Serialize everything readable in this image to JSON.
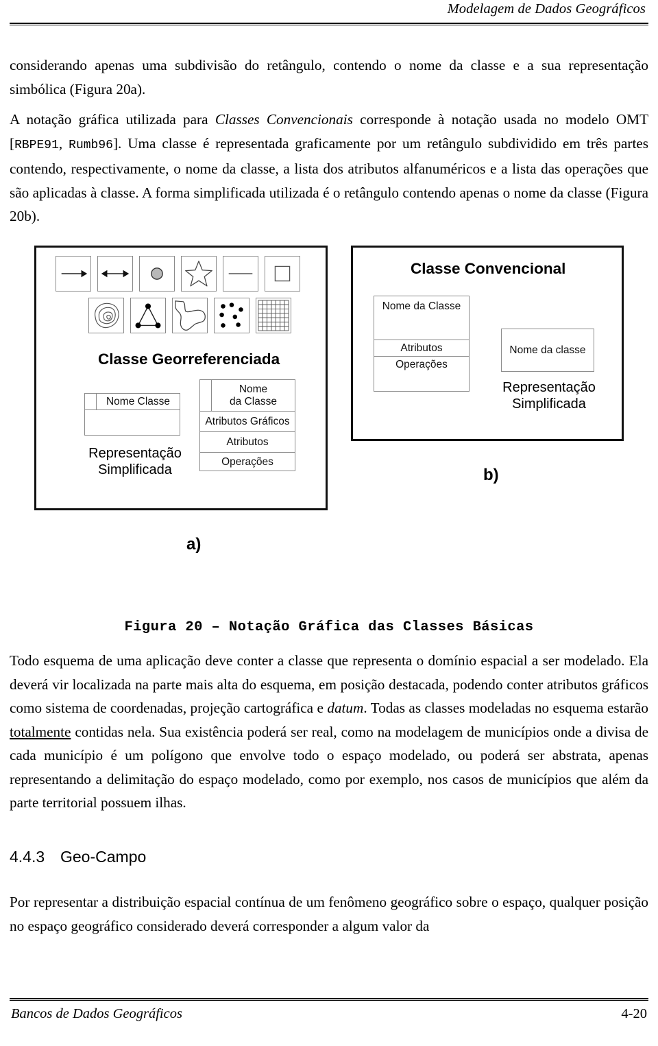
{
  "header": {
    "title": "Modelagem de Dados Geográficos"
  },
  "body": {
    "para1_a": "considerando apenas uma subdivisão do retângulo, contendo o nome da classe e a sua representação simbólica (Figura 20a).",
    "para2_a": "A notação gráfica utilizada para ",
    "para2_italic": "Classes Convencionais",
    "para2_b": " corresponde à notação usada no modelo OMT [",
    "para2_ref1": "RBPE91",
    "para2_c": ", ",
    "para2_ref2": "Rumb96",
    "para2_d": "]. Uma classe é representada graficamente por um retângulo subdividido em três partes contendo, respectivamente, o nome da classe, a lista dos atributos alfanuméricos e a lista das operações que são aplicadas à classe. A forma simplificada utilizada é o retângulo contendo apenas o nome da classe (Figura 20b).",
    "para3_a": "Todo esquema de uma aplicação deve conter a classe que representa o domínio espacial a ser modelado. Ela deverá vir localizada na parte mais alta do esquema, em posição destacada, podendo conter atributos gráficos como sistema de coordenadas, projeção cartográfica e ",
    "para3_italic": "datum",
    "para3_b": ". Todas as classes modeladas no esquema estarão ",
    "para3_underline": "totalmente",
    "para3_c": " contidas nela. Sua existência poderá ser real, como na modelagem de municípios onde a divisa de cada município é um polígono que envolve todo o espaço modelado, ou poderá ser abstrata, apenas representando a delimitação do espaço modelado, como por exemplo, nos casos de municípios que além da parte territorial possuem ilhas.",
    "para4": "Por representar a distribuição espacial contínua de um fenômeno geográfico sobre o espaço, qualquer posição no espaço geográfico considerado deverá corresponder a algum valor da"
  },
  "section": {
    "number": "4.4.3",
    "title": "Geo-Campo"
  },
  "figure": {
    "caption": "Figura 20 – Notação Gráfica das Classes Básicas",
    "panel_a_label": "a)",
    "panel_b_label": "b)",
    "panel_a": {
      "group_title": "Classe Georreferenciada",
      "symbols_row1": [
        "arrow-right-icon",
        "double-arrow-icon",
        "filled-circle-icon",
        "star-icon",
        "line-segment-icon",
        "square-icon"
      ],
      "symbols_row2": [
        "contour-lines-icon",
        "triangle-network-icon",
        "polygon-outline-icon",
        "sample-points-icon",
        "regular-grid-icon"
      ],
      "simple_class": {
        "name": "Nome Classe"
      },
      "simple_label_line1": "Representação",
      "simple_label_line2": "Simplificada",
      "full_class": {
        "name_line1": "Nome",
        "name_line2": "da Classe",
        "row_graphic_attrs": "Atributos Gráficos",
        "row_attrs": "Atributos",
        "row_ops": "Operações"
      }
    },
    "panel_b": {
      "group_title": "Classe Convencional",
      "full_class": {
        "name": "Nome da Classe",
        "row_attrs": "Atributos",
        "row_ops": "Operações"
      },
      "simple_class": {
        "name": "Nome da classe"
      },
      "simple_label_line1": "Representação",
      "simple_label_line2": "Simplificada"
    }
  },
  "footer": {
    "left": "Bancos de Dados Geográficos",
    "page": "4-20"
  },
  "colors": {
    "text": "#000000",
    "panel_border": "#111111",
    "box_border": "#8a8a8a",
    "circle_fill": "#b8b8b8"
  }
}
